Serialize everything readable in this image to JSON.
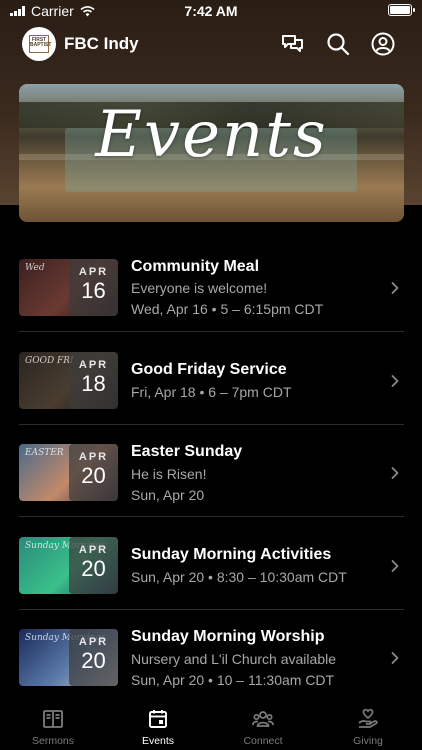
{
  "status": {
    "carrier": "Carrier",
    "time": "7:42 AM"
  },
  "header": {
    "title": "FBC Indy",
    "logo_text": "FIRST BAPTIST"
  },
  "hero": {
    "title": "Events"
  },
  "events": [
    {
      "title": "Community Meal",
      "line1": "Everyone is welcome!",
      "line2": "Wed, Apr 16 • 5 – 6:15pm CDT",
      "month": "APR",
      "day": "16",
      "thumb_text": "Wed",
      "thumb_colors": [
        "#3a2020",
        "#6a3a32",
        "#2a1515"
      ]
    },
    {
      "title": "Good Friday Service",
      "line1": "Fri, Apr 18 • 6 – 7pm CDT",
      "line2": "",
      "month": "APR",
      "day": "18",
      "thumb_text": "GOOD FRI",
      "thumb_colors": [
        "#2a2520",
        "#4a3d30",
        "#1a1612"
      ]
    },
    {
      "title": "Easter Sunday",
      "line1": "He is Risen!",
      "line2": "Sun, Apr 20",
      "month": "APR",
      "day": "20",
      "thumb_text": "EASTER",
      "thumb_colors": [
        "#4a6a8a",
        "#c28a6a",
        "#3a2a3a"
      ]
    },
    {
      "title": "Sunday Morning Activities",
      "line1": "Sun, Apr 20 • 8:30 – 10:30am CDT",
      "line2": "",
      "month": "APR",
      "day": "20",
      "thumb_text": "Sunday Mornings",
      "thumb_colors": [
        "#2a8a7a",
        "#3ac08a",
        "#1a3a5a"
      ]
    },
    {
      "title": "Sunday Morning Worship",
      "line1": "Nursery and L'il Church available",
      "line2": "Sun, Apr 20 • 10 – 11:30am CDT",
      "month": "APR",
      "day": "20",
      "thumb_text": "Sunday Mornings",
      "thumb_colors": [
        "#1a2a5a",
        "#5a7aa8",
        "#c8c8d0"
      ]
    }
  ],
  "tabs": [
    {
      "label": "Sermons",
      "icon": "book-icon",
      "active": false
    },
    {
      "label": "Events",
      "icon": "calendar-icon",
      "active": true
    },
    {
      "label": "Connect",
      "icon": "people-icon",
      "active": false
    },
    {
      "label": "Giving",
      "icon": "heart-hand-icon",
      "active": false
    }
  ]
}
